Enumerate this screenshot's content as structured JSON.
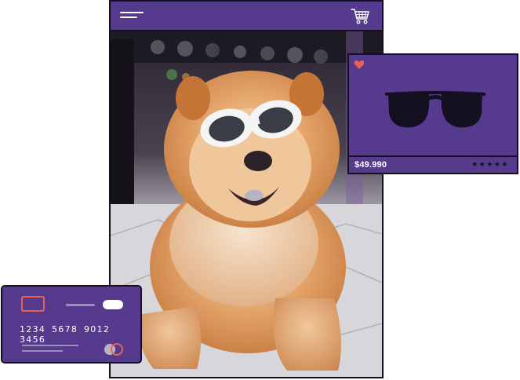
{
  "app": {
    "brand_color": "#553a8e",
    "outline_color": "#141022",
    "accent_color": "#e8634a"
  },
  "header": {
    "menu_icon": "hamburger-menu-icon",
    "cart_icon": "shopping-cart-icon"
  },
  "photo": {
    "subject_icon": "dog-photo"
  },
  "product": {
    "favorite_icon": "heart-icon",
    "image_icon": "sunglasses-icon",
    "price": "$49.990",
    "rating_stars": "★★★★★",
    "rating_value": 5,
    "rating_max": 5
  },
  "card": {
    "number": "1234 5678 9012 3456",
    "chip_icon": "chip-icon",
    "network_icon": "card-network-logo-icon"
  }
}
